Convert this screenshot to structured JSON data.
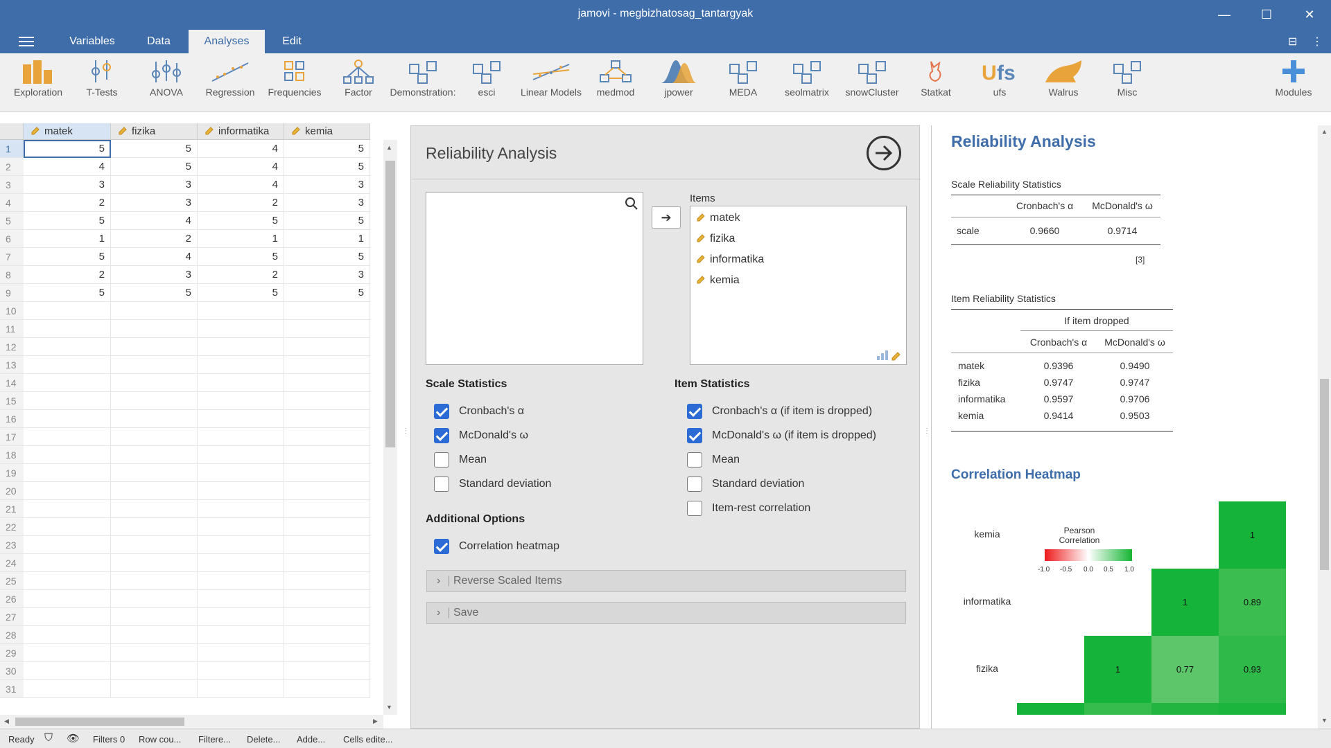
{
  "window": {
    "title": "jamovi - megbizhatosag_tantargyak"
  },
  "menu": {
    "tabs": [
      "Variables",
      "Data",
      "Analyses",
      "Edit"
    ],
    "active": "Analyses"
  },
  "ribbon": {
    "buttons": [
      "Exploration",
      "T-Tests",
      "ANOVA",
      "Regression",
      "Frequencies",
      "Factor",
      "Demonstration:",
      "esci",
      "Linear Models",
      "medmod",
      "jpower",
      "MEDA",
      "seolmatrix",
      "snowCluster",
      "Statkat",
      "ufs",
      "Walrus",
      "Misc"
    ],
    "modules_label": "Modules"
  },
  "sheet": {
    "columns": [
      "matek",
      "fizika",
      "informatika",
      "kemia"
    ],
    "rows": [
      [
        "5",
        "5",
        "4",
        "5"
      ],
      [
        "4",
        "5",
        "4",
        "5"
      ],
      [
        "3",
        "3",
        "4",
        "3"
      ],
      [
        "2",
        "3",
        "2",
        "3"
      ],
      [
        "5",
        "4",
        "5",
        "5"
      ],
      [
        "1",
        "2",
        "1",
        "1"
      ],
      [
        "5",
        "4",
        "5",
        "5"
      ],
      [
        "2",
        "3",
        "2",
        "3"
      ],
      [
        "5",
        "5",
        "5",
        "5"
      ]
    ],
    "row_numbers": [
      "1",
      "2",
      "3",
      "4",
      "5",
      "6",
      "7",
      "8",
      "9",
      "10",
      "11",
      "12",
      "13",
      "14",
      "15",
      "16",
      "17",
      "18",
      "19",
      "20",
      "21",
      "22",
      "23",
      "24",
      "25",
      "26",
      "27",
      "28",
      "29",
      "30",
      "31"
    ]
  },
  "options": {
    "title": "Reliability Analysis",
    "items_label": "Items",
    "items": [
      "matek",
      "fizika",
      "informatika",
      "kemia"
    ],
    "scale_statistics": {
      "heading": "Scale Statistics",
      "cronbach": "Cronbach's α",
      "mcdonald": "McDonald's ω",
      "mean": "Mean",
      "sd": "Standard deviation"
    },
    "item_statistics": {
      "heading": "Item Statistics",
      "cronbach": "Cronbach's α (if item is dropped)",
      "mcdonald": "McDonald's ω (if item is dropped)",
      "mean": "Mean",
      "sd": "Standard deviation",
      "item_rest": "Item-rest correlation"
    },
    "additional": {
      "heading": "Additional Options",
      "heatmap": "Correlation heatmap"
    },
    "reverse_label": "Reverse Scaled Items",
    "save_label": "Save"
  },
  "results": {
    "title": "Reliability Analysis",
    "scale_table": {
      "title": "Scale Reliability Statistics",
      "col1": "Cronbach's α",
      "col2": "McDonald's ω",
      "row_label": "scale",
      "alpha": "0.9660",
      "omega": "0.9714",
      "footnote": "[3]"
    },
    "item_table": {
      "title": "Item Reliability Statistics",
      "group_header": "If item dropped",
      "col1": "Cronbach's α",
      "col2": "McDonald's ω",
      "rows": [
        {
          "name": "matek",
          "alpha": "0.9396",
          "omega": "0.9490"
        },
        {
          "name": "fizika",
          "alpha": "0.9747",
          "omega": "0.9747"
        },
        {
          "name": "informatika",
          "alpha": "0.9597",
          "omega": "0.9706"
        },
        {
          "name": "kemia",
          "alpha": "0.9414",
          "omega": "0.9503"
        }
      ]
    },
    "heatmap": {
      "title": "Correlation Heatmap",
      "legend_title_1": "Pearson",
      "legend_title_2": "Correlation",
      "legend_ticks": [
        "-1.0",
        "-0.5",
        "0.0",
        "0.5",
        "1.0"
      ],
      "row_labels": [
        "kemia",
        "informatika",
        "fizika"
      ],
      "cells": {
        "kemia_kemia": "1",
        "informatika_informatika": "1",
        "informatika_kemia": "0.89",
        "fizika_fizika": "1",
        "fizika_informatika": "0.77",
        "fizika_kemia": "0.93"
      }
    }
  },
  "status": {
    "ready": "Ready",
    "filters": "Filters 0",
    "row_count": "Row cou...",
    "filtered": "Filtere...",
    "deleted": "Delete...",
    "added": "Adde...",
    "cells_edited": "Cells edite..."
  },
  "colors": {
    "accent": "#3e6da9",
    "check": "#2c6ad6",
    "heat_strong": "#16b33a",
    "heat_mid": "#5dc56a",
    "heat_89": "#3bbd50"
  }
}
